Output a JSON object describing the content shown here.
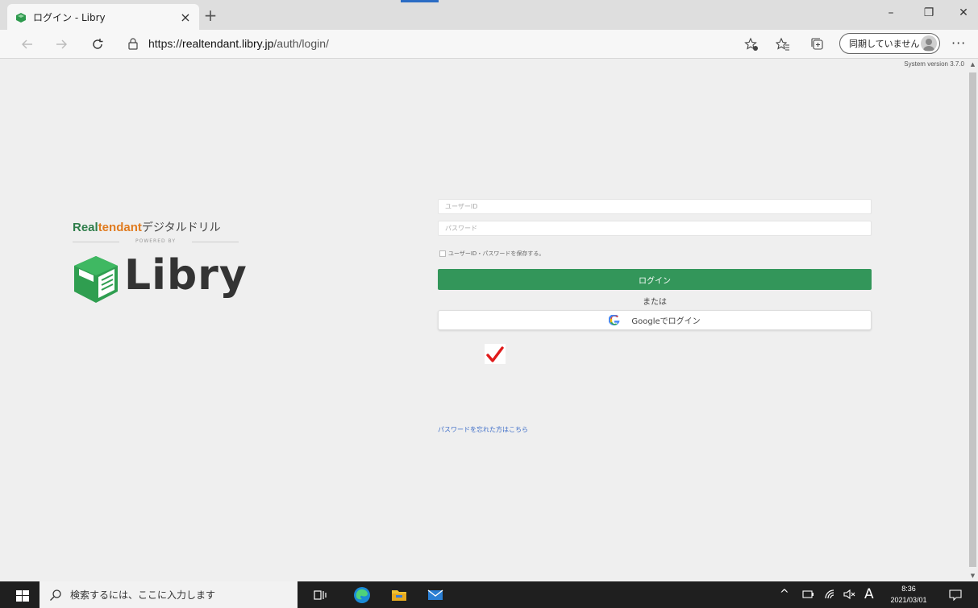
{
  "browser": {
    "tab_title": "ログイン - Libry",
    "tab_close": "×",
    "new_tab": "+",
    "url_prefix": "https://",
    "url_host": "realtendant.libry.jp",
    "url_path": "/auth/login/",
    "sync_label": "同期していません",
    "more": "···",
    "window": {
      "minimize": "–",
      "restore": "❐",
      "close": "✕"
    },
    "icons": [
      "back-arrow-icon",
      "forward-arrow-icon",
      "refresh-icon",
      "lock-icon",
      "add-favorite-icon",
      "favorites-icon",
      "collections-icon",
      "profile-icon"
    ]
  },
  "page": {
    "system_version": "System version 3.7.0",
    "brand": {
      "real": "Real",
      "tendant": "tendant",
      "suffix": "デジタルドリル",
      "powered_by": "POWERED BY",
      "libry": "Libry"
    },
    "colors": {
      "brand_green": "#33965a",
      "brand_orange": "#e07b1f",
      "link_blue": "#3d6dc8"
    },
    "form": {
      "user_id_placeholder": "ユーザーID",
      "password_placeholder": "パスワード",
      "remember_label": "ユーザーID・パスワードを保存する。",
      "login_button": "ログイン",
      "or_text": "または",
      "google_button": "Googleでログイン",
      "forgot_link": "パスワードを忘れた方はこちら"
    },
    "annotation_mark": "✔"
  },
  "taskbar": {
    "search_placeholder": "検索するには、ここに入力します",
    "ime": "A",
    "time": "8:36",
    "date": "2021/03/01",
    "tray_up": "^"
  }
}
